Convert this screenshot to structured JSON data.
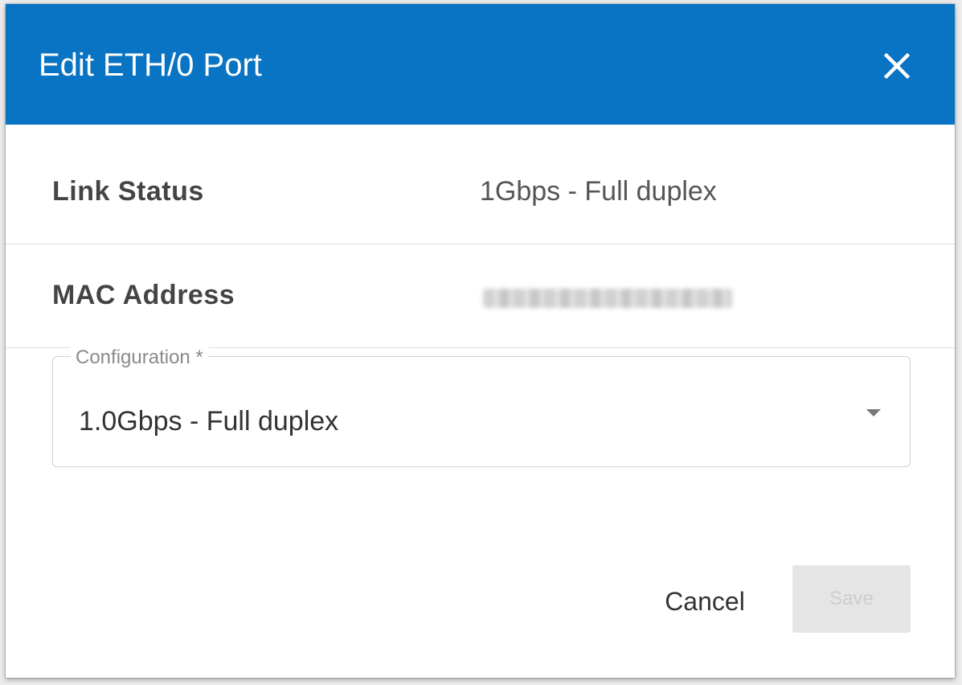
{
  "dialog": {
    "title": "Edit ETH/0 Port",
    "close_icon": "close-icon",
    "header_color": "#0a74c4"
  },
  "info": {
    "link_status_label": "Link Status",
    "link_status_value": "1Gbps - Full duplex",
    "mac_address_label": "MAC Address",
    "mac_address_value_redacted": true
  },
  "configuration": {
    "label": "Configuration *",
    "selected": "1.0Gbps - Full duplex",
    "arrow_icon": "dropdown-arrow-icon"
  },
  "actions": {
    "cancel_label": "Cancel",
    "save_label": "Save",
    "save_disabled": true
  }
}
